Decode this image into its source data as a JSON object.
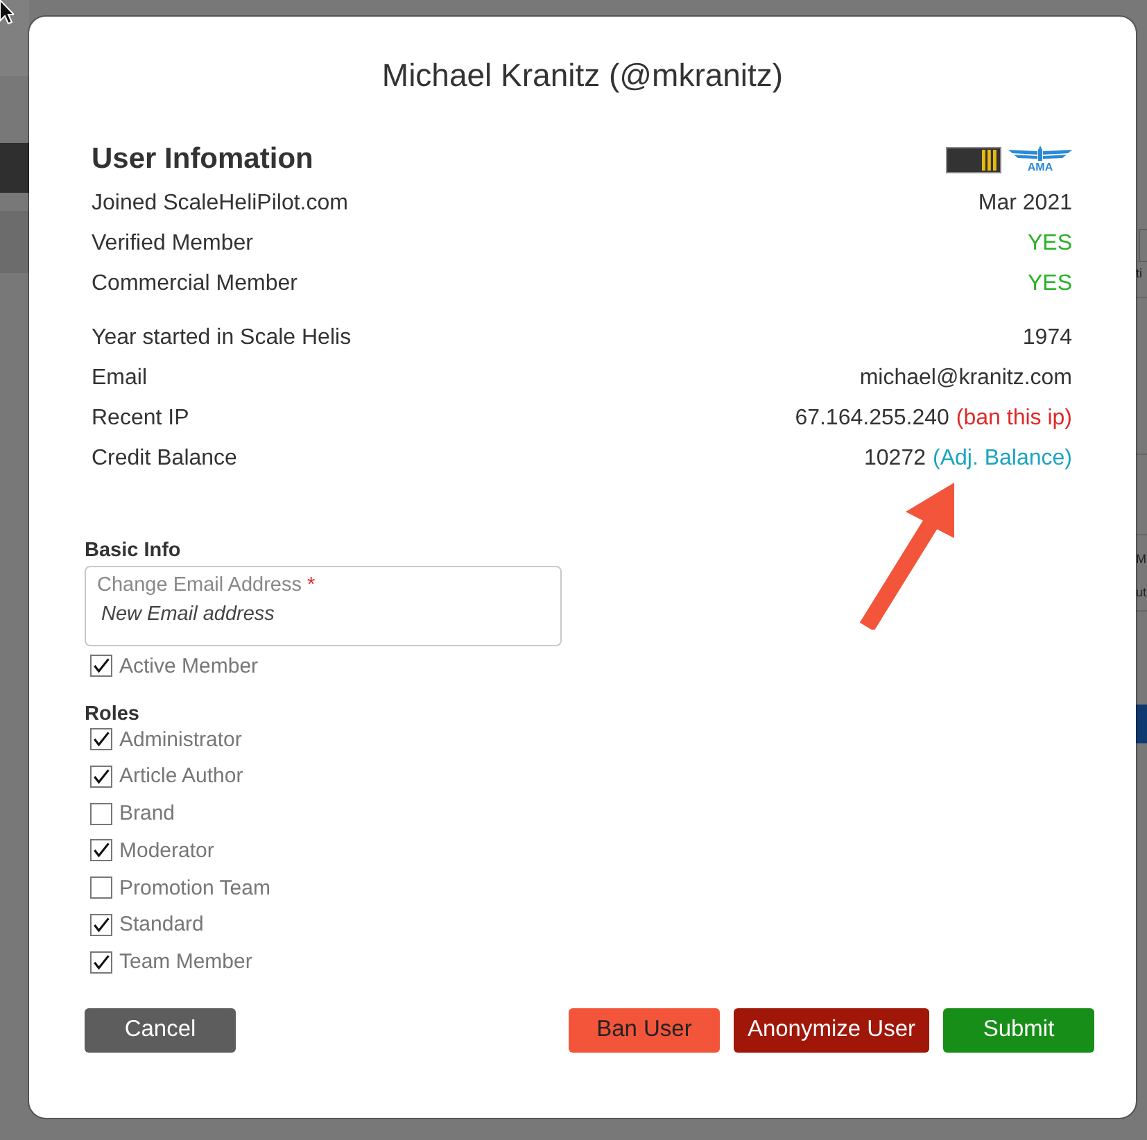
{
  "background_page": {
    "fragments": [
      "ti",
      "M",
      "ut"
    ]
  },
  "dialog": {
    "title": "Michael Kranitz (@mkranitz)"
  },
  "user_info": {
    "title": "User Infomation",
    "badges": [
      {
        "kind": "rank"
      },
      {
        "kind": "wings",
        "label": "AMA"
      }
    ],
    "groups": [
      {
        "rows": [
          {
            "label": "Joined ScaleHeliPilot.com",
            "value": "Mar 2021",
            "kind": "text"
          },
          {
            "label": "Verified Member",
            "value": "YES",
            "kind": "flag"
          },
          {
            "label": "Commercial Member",
            "value": "YES",
            "kind": "flag"
          }
        ]
      },
      {
        "rows": [
          {
            "label": "Year started in Scale Helis",
            "value": "1974",
            "kind": "text"
          },
          {
            "label": "Email",
            "value": "michael@kranitz.com",
            "kind": "text"
          },
          {
            "label": "Recent IP",
            "value": "67.164.255.240",
            "kind": "text",
            "link": {
              "text": "(ban this ip)",
              "kind": "danger"
            }
          },
          {
            "label": "Credit Balance",
            "value": "10272",
            "kind": "text",
            "link": {
              "text": "(Adj. Balance)",
              "kind": "info"
            }
          }
        ]
      }
    ]
  },
  "basic_info": {
    "title": "Basic Info",
    "email_field": {
      "label": "Change Email Address",
      "required_mark": "*",
      "placeholder": "New Email address"
    },
    "active_member": {
      "label": "Active Member",
      "checked": true
    }
  },
  "roles": {
    "title": "Roles",
    "items": [
      {
        "label": "Administrator",
        "checked": true
      },
      {
        "label": "Article Author",
        "checked": true
      },
      {
        "label": "Brand",
        "checked": false
      },
      {
        "label": "Moderator",
        "checked": true
      },
      {
        "label": "Promotion Team",
        "checked": false
      },
      {
        "label": "Standard",
        "checked": true
      },
      {
        "label": "Team Member",
        "checked": true
      }
    ]
  },
  "buttons": [
    {
      "label": "Cancel",
      "kind": "cancel"
    },
    {
      "label": "Ban User",
      "kind": "danger"
    },
    {
      "label": "Anonymize User",
      "kind": "destructive"
    },
    {
      "label": "Submit",
      "kind": "submit"
    }
  ]
}
